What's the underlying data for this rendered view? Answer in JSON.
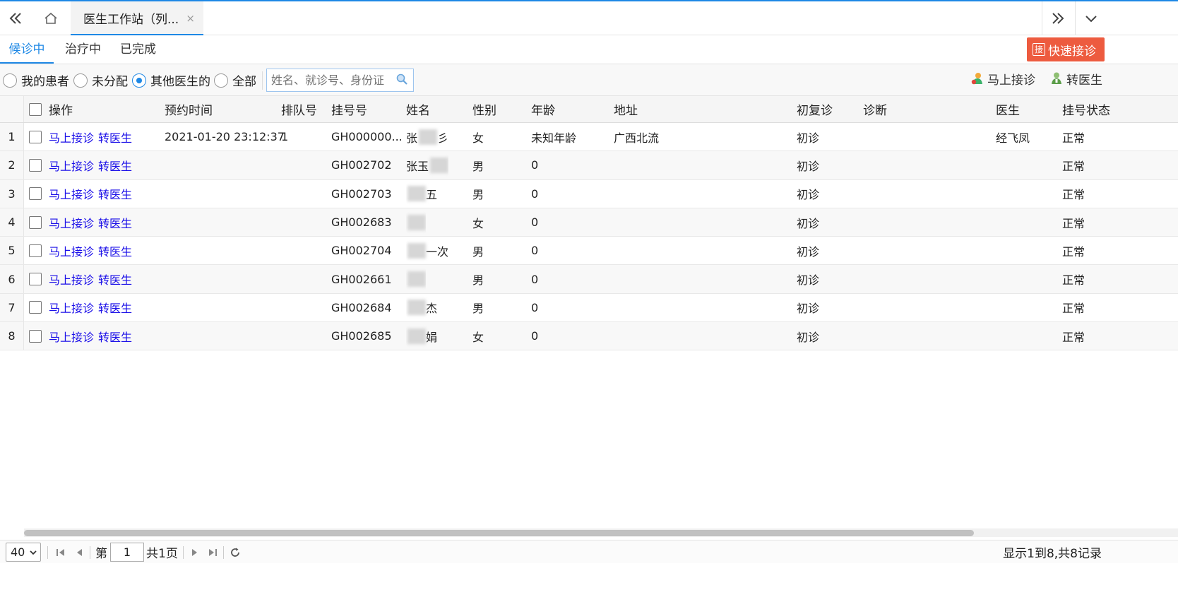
{
  "topbar": {
    "tab_title": "医生工作站（列...",
    "tab_close": "×"
  },
  "status_tabs": [
    "候诊中",
    "治疗中",
    "已完成"
  ],
  "quick_button": {
    "icon_text": "接",
    "label": "快速接诊"
  },
  "filters": {
    "options": [
      "我的患者",
      "未分配",
      "其他医生的",
      "全部"
    ],
    "selected": "其他医生的",
    "search_placeholder": "姓名、就诊号、身份证"
  },
  "toolbar": {
    "receive": "马上接诊",
    "transfer": "转医生"
  },
  "columns": [
    "操作",
    "预约时间",
    "排队号",
    "挂号号",
    "姓名",
    "性别",
    "年龄",
    "地址",
    "初复诊",
    "诊断",
    "医生",
    "挂号状态"
  ],
  "actions": {
    "receive": "马上接诊",
    "transfer": "转医生"
  },
  "rows": [
    {
      "num": "1",
      "time": "2021-01-20 23:12:37",
      "queue": "1",
      "reg": "GH000000...",
      "name_a": "张",
      "name_b": "彡",
      "sex": "女",
      "age": "未知年龄",
      "addr": "广西北流",
      "visit": "初诊",
      "diag": "",
      "doctor": "经飞凤",
      "status": "正常"
    },
    {
      "num": "2",
      "time": "",
      "queue": "",
      "reg": "GH002702",
      "name_a": "张玉",
      "name_b": "",
      "sex": "男",
      "age": "0",
      "addr": "",
      "visit": "初诊",
      "diag": "",
      "doctor": "",
      "status": "正常"
    },
    {
      "num": "3",
      "time": "",
      "queue": "",
      "reg": "GH002703",
      "name_a": "",
      "name_b": "五",
      "sex": "男",
      "age": "0",
      "addr": "",
      "visit": "初诊",
      "diag": "",
      "doctor": "",
      "status": "正常"
    },
    {
      "num": "4",
      "time": "",
      "queue": "",
      "reg": "GH002683",
      "name_a": "",
      "name_b": "",
      "sex": "女",
      "age": "0",
      "addr": "",
      "visit": "初诊",
      "diag": "",
      "doctor": "",
      "status": "正常"
    },
    {
      "num": "5",
      "time": "",
      "queue": "",
      "reg": "GH002704",
      "name_a": "",
      "name_b": "一次",
      "sex": "男",
      "age": "0",
      "addr": "",
      "visit": "初诊",
      "diag": "",
      "doctor": "",
      "status": "正常"
    },
    {
      "num": "6",
      "time": "",
      "queue": "",
      "reg": "GH002661",
      "name_a": "",
      "name_b": "",
      "sex": "男",
      "age": "0",
      "addr": "",
      "visit": "初诊",
      "diag": "",
      "doctor": "",
      "status": "正常"
    },
    {
      "num": "7",
      "time": "",
      "queue": "",
      "reg": "GH002684",
      "name_a": "",
      "name_b": "杰",
      "sex": "男",
      "age": "0",
      "addr": "",
      "visit": "初诊",
      "diag": "",
      "doctor": "",
      "status": "正常"
    },
    {
      "num": "8",
      "time": "",
      "queue": "",
      "reg": "GH002685",
      "name_a": "",
      "name_b": "娟",
      "sex": "女",
      "age": "0",
      "addr": "",
      "visit": "初诊",
      "diag": "",
      "doctor": "",
      "status": "正常"
    }
  ],
  "pager": {
    "page_size": "40",
    "page_prefix": "第",
    "page_value": "1",
    "page_total": "共1页",
    "summary": "显示1到8,共8记录"
  },
  "icons": {
    "collapse": "double-chevron-left-icon",
    "home": "home-icon",
    "expand": "double-chevron-right-icon",
    "menu": "chevron-down-icon",
    "search": "search-icon",
    "receive": "doctor-color-icon",
    "transfer": "doctor-green-icon",
    "refresh": "refresh-icon"
  },
  "colors": {
    "accent": "#1e88e5",
    "quick_button": "#ed5b3f",
    "action_link": "#1a0ee8"
  }
}
